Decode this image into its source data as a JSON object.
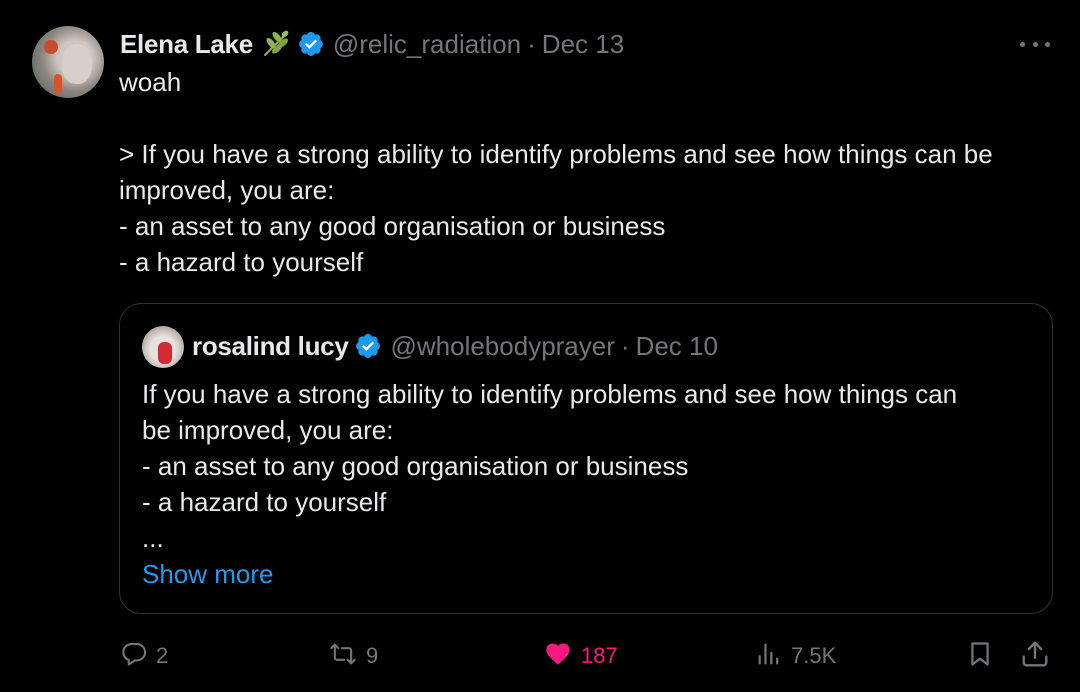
{
  "author": {
    "display_name": "Elena Lake",
    "handle": "@relic_radiation",
    "separator": "·",
    "date": "Dec 13",
    "emoji": "herb-emoji",
    "verified": true
  },
  "tweet": {
    "lines": [
      "woah",
      "",
      "> If you have a strong ability to identify problems and see how things can be",
      "improved, you are:",
      "- an asset to any good organisation or business",
      "- a hazard to yourself"
    ]
  },
  "quote": {
    "display_name": "rosalind lucy",
    "handle": "@wholebodyprayer",
    "separator": "·",
    "date": "Dec 10",
    "verified": true,
    "lines": [
      "If you have a strong ability to identify problems and see how things can",
      "be improved, you are:",
      "- an asset to any good organisation or business",
      "- a hazard to yourself",
      "..."
    ],
    "show_more": "Show more"
  },
  "actions": {
    "replies": "2",
    "retweets": "9",
    "likes": "187",
    "views": "7.5K",
    "liked": true
  },
  "colors": {
    "background": "#000000",
    "text": "#e7e9ea",
    "muted": "#71767b",
    "accent": "#1d9bf0",
    "like": "#f91880",
    "border": "#2f3336"
  }
}
